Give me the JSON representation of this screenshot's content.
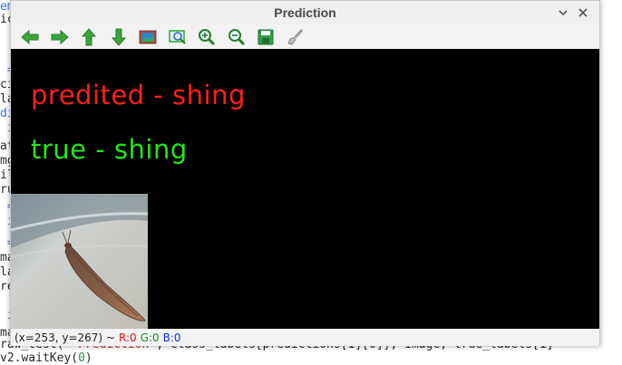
{
  "window": {
    "title": "Prediction",
    "minimize_glyph": "⌄",
    "close_glyph": "✕"
  },
  "toolbar": {
    "buttons": [
      {
        "name": "back-arrow-icon"
      },
      {
        "name": "forward-arrow-icon"
      },
      {
        "name": "up-arrow-icon"
      },
      {
        "name": "down-arrow-icon"
      },
      {
        "name": "image-icon"
      },
      {
        "name": "zoom-area-icon"
      },
      {
        "name": "zoom-in-icon"
      },
      {
        "name": "zoom-out-icon"
      },
      {
        "name": "save-icon"
      },
      {
        "name": "settings-brush-icon"
      }
    ]
  },
  "canvas": {
    "predicted_text": "predited - shing",
    "true_text": "true - shing"
  },
  "status": {
    "coords": "(x=253, y=267) ~",
    "r": "R:0",
    "g": "G:0",
    "b": "B:0"
  },
  "background_code": {
    "bottom_line1_a": "raw_test( ",
    "bottom_line1_str": "\"Prediction\"",
    "bottom_line1_b": ", class_labels[predictions[1][0]], image, true_labels[1]",
    "bottom_line2_a": "v2.waitKey(",
    "bottom_line2_num": "0",
    "bottom_line2_b": ")"
  },
  "colors": {
    "predicted": "#ff1f1f",
    "true": "#22e61a",
    "toolbar_green": "#3aa53a"
  }
}
